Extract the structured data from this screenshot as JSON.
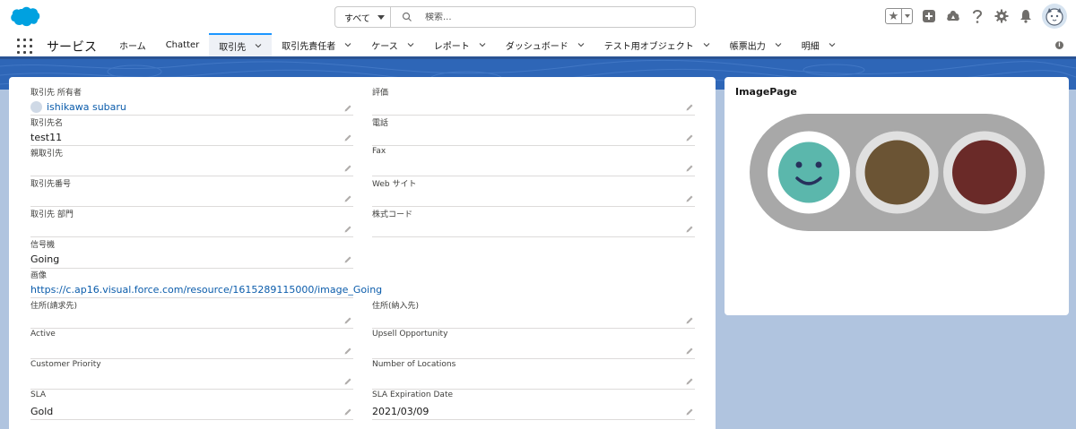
{
  "header": {
    "search_scope": "すべて",
    "search_placeholder": "検索...",
    "icons": [
      "salesforce-logo",
      "favorites-star-icon",
      "add-icon",
      "trailhead-icon",
      "help-icon",
      "settings-gear-icon",
      "notifications-bell-icon",
      "user-avatar"
    ]
  },
  "nav": {
    "app_name": "サービス",
    "items": [
      {
        "label": "ホーム",
        "chevron": false
      },
      {
        "label": "Chatter",
        "chevron": false
      },
      {
        "label": "取引先",
        "chevron": true,
        "active": true
      },
      {
        "label": "取引先責任者",
        "chevron": true
      },
      {
        "label": "ケース",
        "chevron": true
      },
      {
        "label": "レポート",
        "chevron": true
      },
      {
        "label": "ダッシュボード",
        "chevron": true
      },
      {
        "label": "テスト用オブジェクト",
        "chevron": true
      },
      {
        "label": "帳票出力",
        "chevron": true
      },
      {
        "label": "明細",
        "chevron": true
      }
    ]
  },
  "detail": {
    "left": [
      {
        "label": "取引先 所有者",
        "value": "ishikawa subaru",
        "type": "owner"
      },
      {
        "label": "取引先名",
        "value": "test11"
      },
      {
        "label": "親取引先",
        "value": ""
      },
      {
        "label": "取引先番号",
        "value": ""
      },
      {
        "label": "取引先 部門",
        "value": ""
      },
      {
        "label": "信号機",
        "value": "Going"
      },
      {
        "label": "画像",
        "value": "https://c.ap16.visual.force.com/resource/1615289115000/image_Going",
        "type": "link"
      },
      {
        "label": "住所(請求先)",
        "value": ""
      },
      {
        "label": "Active",
        "value": ""
      },
      {
        "label": "Customer Priority",
        "value": ""
      },
      {
        "label": "SLA",
        "value": "Gold"
      }
    ],
    "right": [
      {
        "label": "評価",
        "value": ""
      },
      {
        "label": "電話",
        "value": ""
      },
      {
        "label": "Fax",
        "value": ""
      },
      {
        "label": "Web サイト",
        "value": ""
      },
      {
        "label": "株式コード",
        "value": ""
      },
      {
        "label": "住所(納入先)",
        "value": ""
      },
      {
        "label": "Upsell Opportunity",
        "value": ""
      },
      {
        "label": "Number of Locations",
        "value": ""
      },
      {
        "label": "SLA Expiration Date",
        "value": "2021/03/09"
      }
    ]
  },
  "image_page": {
    "title": "ImagePage",
    "colors": {
      "go": "#5bb7ac",
      "caution": "#6b5434",
      "stop": "#6a2a28",
      "housing": "#a8a8a8"
    }
  }
}
